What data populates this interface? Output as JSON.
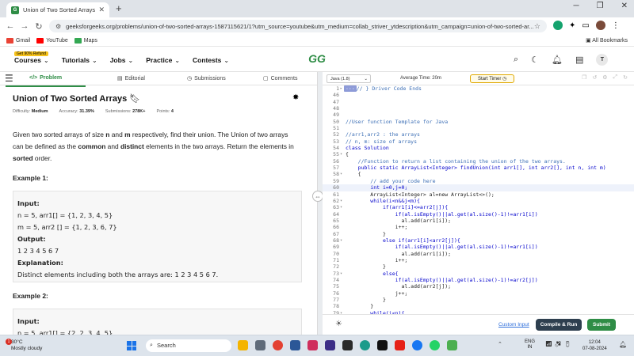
{
  "browser": {
    "tab_title": "Union of Two Sorted Arrays | Pr",
    "url": "geeksforgeeks.org/problems/union-of-two-sorted-arrays-1587115621/1?utm_source=youtube&utm_medium=collab_striver_ytdescription&utm_campaign=union-of-two-sorted-ar...",
    "bookmarks": [
      {
        "label": "Gmail",
        "color": "#ea4335"
      },
      {
        "label": "YouTube",
        "color": "#ff0000"
      },
      {
        "label": "Maps",
        "color": "#34a853"
      }
    ],
    "all_bookmarks": "All Bookmarks"
  },
  "header": {
    "refund_badge": "Get 90% Refund",
    "nav": [
      "Courses",
      "Tutorials",
      "Jobs",
      "Practice",
      "Contests"
    ],
    "logo": "GG",
    "avatar": "T"
  },
  "left_tabs": [
    "Problem",
    "Editorial",
    "Submissions",
    "Comments"
  ],
  "problem": {
    "title": "Union of Two Sorted Arrays",
    "difficulty_label": "Difficulty:",
    "difficulty": "Medium",
    "accuracy_label": "Accuracy:",
    "accuracy": "31.39%",
    "submissions_label": "Submissions:",
    "submissions": "278K+",
    "points_label": "Points:",
    "points": "4",
    "desc": {
      "p1": "Given two sorted arrays of size ",
      "n": "n",
      "p2": " and ",
      "m": "m",
      "p3": " respectively, find their union. The Union of two arrays can be defined as the ",
      "common": "common",
      "p4": " and ",
      "distinct": "distinct",
      "p5": " elements in the two arrays. Return the elements in ",
      "sorted": "sorted",
      "p6": " order."
    },
    "example1_title": "Example 1:",
    "example1": {
      "input_label": "Input:",
      "line1": "n = 5, arr1[] = {1, 2, 3, 4, 5}",
      "line2": "m = 5, arr2 [] = {1, 2, 3, 6, 7}",
      "output_label": "Output:",
      "output": "1 2 3 4 5 6 7",
      "explanation_label": "Explanation:",
      "explanation": "Distinct elements including both the arrays are: 1 2 3 4 5 6 7."
    },
    "example2_title": "Example 2:",
    "example2": {
      "input_label": "Input:",
      "line1": "n = 5, arr1[] = {2, 2, 3, 4, 5}"
    }
  },
  "editor": {
    "language": "Java (1.8)",
    "avg_time_label": "Average Time: 20m",
    "start_timer": "Start Timer",
    "lines": [
      {
        "n": "1",
        "t": "// } Driver Code Ends",
        "c": "cm",
        "fold": "▸",
        "mark": "···"
      },
      {
        "n": "46",
        "t": "",
        "c": "tx"
      },
      {
        "n": "47",
        "t": "",
        "c": "tx"
      },
      {
        "n": "48",
        "t": "",
        "c": "tx"
      },
      {
        "n": "49",
        "t": "",
        "c": "tx"
      },
      {
        "n": "50",
        "t": "//User function Template for Java",
        "c": "cm"
      },
      {
        "n": "51",
        "t": "",
        "c": "tx"
      },
      {
        "n": "52",
        "t": "//arr1,arr2 : the arrays",
        "c": "cm"
      },
      {
        "n": "53",
        "t": "// n, m: size of arrays",
        "c": "cm"
      },
      {
        "n": "54",
        "t": "class Solution",
        "c": "kw"
      },
      {
        "n": "55",
        "t": "{",
        "c": "tx",
        "fold": "▾"
      },
      {
        "n": "56",
        "t": "    //Function to return a list containing the union of the two arrays.",
        "c": "cm"
      },
      {
        "n": "57",
        "t": "    public static ArrayList<Integer> findUnion(int arr1[], int arr2[], int n, int m)",
        "c": "kw"
      },
      {
        "n": "58",
        "t": "    {",
        "c": "tx",
        "fold": "▾"
      },
      {
        "n": "59",
        "t": "        // add your code here",
        "c": "cm"
      },
      {
        "n": "60",
        "t": "        int i=0,j=0;",
        "c": "kw",
        "hl": true
      },
      {
        "n": "61",
        "t": "        ArrayList<Integer> al=new ArrayList<>();",
        "c": "tx"
      },
      {
        "n": "62",
        "t": "        while(i<n&&j<m){",
        "c": "kw",
        "fold": "▾"
      },
      {
        "n": "63",
        "t": "            if(arr1[i]<=arr2[j]){",
        "c": "kw",
        "fold": "▾"
      },
      {
        "n": "64",
        "t": "                if(al.isEmpty()||al.get(al.size()-1)!=arr1[i])",
        "c": "kw"
      },
      {
        "n": "65",
        "t": "                  al.add(arr1[i]);",
        "c": "tx"
      },
      {
        "n": "66",
        "t": "                i++;",
        "c": "tx"
      },
      {
        "n": "67",
        "t": "            }",
        "c": "tx"
      },
      {
        "n": "68",
        "t": "            else if(arr1[i]<arr2[j]){",
        "c": "kw",
        "fold": "▾"
      },
      {
        "n": "69",
        "t": "                if(al.isEmpty()||al.get(al.size()-1)!=arr1[i])",
        "c": "kw"
      },
      {
        "n": "70",
        "t": "                  al.add(arr1[i]);",
        "c": "tx"
      },
      {
        "n": "71",
        "t": "                i++;",
        "c": "tx"
      },
      {
        "n": "72",
        "t": "            }",
        "c": "tx"
      },
      {
        "n": "73",
        "t": "            else{",
        "c": "kw",
        "fold": "▾"
      },
      {
        "n": "74",
        "t": "                if(al.isEmpty()||al.get(al.size()-1)!=arr2[j])",
        "c": "kw"
      },
      {
        "n": "75",
        "t": "                  al.add(arr2[j]);",
        "c": "tx"
      },
      {
        "n": "76",
        "t": "                j++;",
        "c": "tx"
      },
      {
        "n": "77",
        "t": "            }",
        "c": "tx"
      },
      {
        "n": "78",
        "t": "        }",
        "c": "tx"
      },
      {
        "n": "79",
        "t": "        while(i<n){",
        "c": "kw",
        "fold": "▾"
      }
    ],
    "custom_input": "Custom Input",
    "compile_run": "Compile & Run",
    "submit": "Submit"
  },
  "taskbar": {
    "notification_count": "1",
    "temperature": "30°C",
    "weather": "Mostly cloudy",
    "search": "Search",
    "lang_line1": "ENG",
    "lang_line2": "IN",
    "time": "12:04",
    "date": "07-08-2024"
  },
  "colors": {
    "brand_green": "#2f8d46",
    "compile_button": "#2e3f4f",
    "timer_border": "#e0a800"
  }
}
